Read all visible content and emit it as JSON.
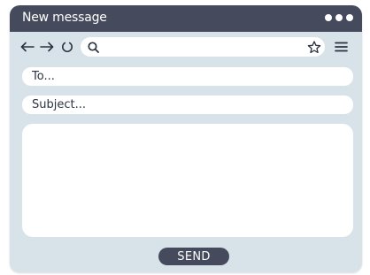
{
  "window": {
    "title": "New message"
  },
  "nav": {
    "back_icon": "arrow-left-icon",
    "forward_icon": "arrow-right-icon",
    "reload_icon": "reload-icon",
    "search_icon": "search-icon",
    "favorite_icon": "star-icon",
    "menu_icon": "hamburger-menu-icon",
    "address_value": ""
  },
  "form": {
    "to_placeholder": "To...",
    "subject_placeholder": "Subject...",
    "message_value": ""
  },
  "actions": {
    "send_label": "SEND"
  },
  "colors": {
    "titlebar": "#454b5c",
    "window_background": "#d7e3e8",
    "field_background": "#ffffff",
    "button": "#454b5c",
    "icon": "#2c3340"
  }
}
